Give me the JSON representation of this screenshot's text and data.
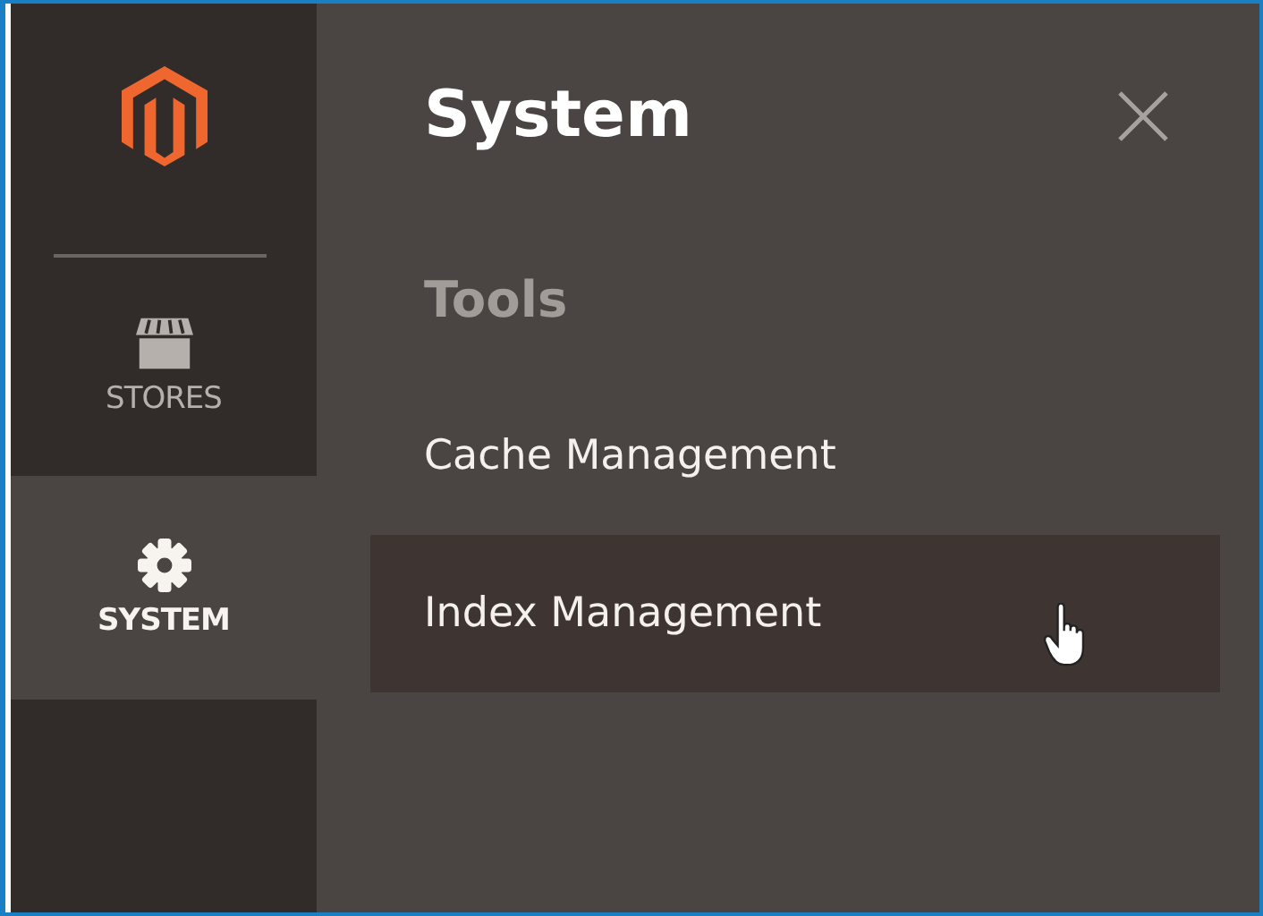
{
  "sidebar": {
    "items": [
      {
        "kind": "stores",
        "label": "STORES",
        "selected": false
      },
      {
        "kind": "system",
        "label": "SYSTEM",
        "selected": true
      }
    ]
  },
  "panel": {
    "title": "System",
    "sections": [
      {
        "heading": "Tools",
        "items": [
          {
            "label": "Cache Management",
            "hovered": false
          },
          {
            "label": "Index Management",
            "hovered": true
          }
        ]
      }
    ]
  }
}
